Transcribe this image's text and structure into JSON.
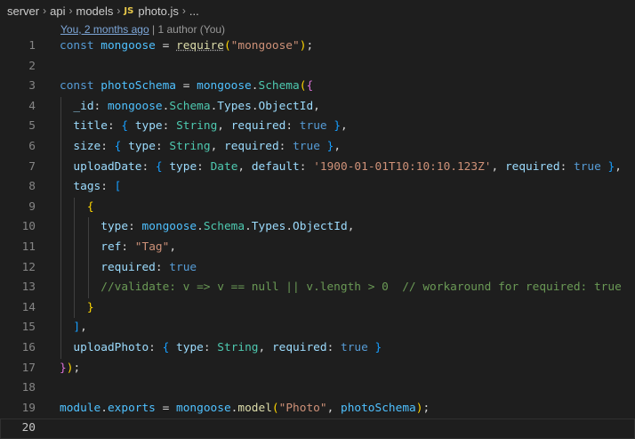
{
  "breadcrumb": {
    "items": [
      "server",
      "api",
      "models"
    ],
    "file_badge": "JS",
    "file_name": "photo.js",
    "trailing": "..."
  },
  "blame": {
    "link": "You, 2 months ago",
    "sep": " | ",
    "author": "1 author (You)"
  },
  "editor": {
    "current_line": 20,
    "lines": [
      {
        "n": "1",
        "tokens": [
          [
            "kw",
            "const"
          ],
          [
            "pun",
            " "
          ],
          [
            "var",
            "mongoose"
          ],
          [
            "pun",
            " = "
          ],
          [
            "fn",
            "require"
          ],
          [
            "b1",
            "("
          ],
          [
            "str",
            "\"mongoose\""
          ],
          [
            "b1",
            ")"
          ],
          [
            "pun",
            ";"
          ]
        ]
      },
      {
        "n": "2",
        "tokens": []
      },
      {
        "n": "3",
        "tokens": [
          [
            "kw",
            "const"
          ],
          [
            "pun",
            " "
          ],
          [
            "var",
            "photoSchema"
          ],
          [
            "pun",
            " = "
          ],
          [
            "var",
            "mongoose"
          ],
          [
            "pun",
            "."
          ],
          [
            "typ",
            "Schema"
          ],
          [
            "b1",
            "("
          ],
          [
            "b2",
            "{"
          ]
        ]
      },
      {
        "n": "4",
        "tokens": [
          [
            "pun",
            "  "
          ],
          [
            "prop",
            "_id"
          ],
          [
            "pun",
            ": "
          ],
          [
            "var",
            "mongoose"
          ],
          [
            "pun",
            "."
          ],
          [
            "typ",
            "Schema"
          ],
          [
            "pun",
            "."
          ],
          [
            "prop",
            "Types"
          ],
          [
            "pun",
            "."
          ],
          [
            "prop",
            "ObjectId"
          ],
          [
            "pun",
            ","
          ]
        ]
      },
      {
        "n": "5",
        "tokens": [
          [
            "pun",
            "  "
          ],
          [
            "prop",
            "title"
          ],
          [
            "pun",
            ": "
          ],
          [
            "b3",
            "{"
          ],
          [
            "pun",
            " "
          ],
          [
            "prop",
            "type"
          ],
          [
            "pun",
            ": "
          ],
          [
            "typ",
            "String"
          ],
          [
            "pun",
            ", "
          ],
          [
            "prop",
            "required"
          ],
          [
            "pun",
            ": "
          ],
          [
            "kw",
            "true"
          ],
          [
            "pun",
            " "
          ],
          [
            "b3",
            "}"
          ],
          [
            "pun",
            ","
          ]
        ]
      },
      {
        "n": "6",
        "tokens": [
          [
            "pun",
            "  "
          ],
          [
            "prop",
            "size"
          ],
          [
            "pun",
            ": "
          ],
          [
            "b3",
            "{"
          ],
          [
            "pun",
            " "
          ],
          [
            "prop",
            "type"
          ],
          [
            "pun",
            ": "
          ],
          [
            "typ",
            "String"
          ],
          [
            "pun",
            ", "
          ],
          [
            "prop",
            "required"
          ],
          [
            "pun",
            ": "
          ],
          [
            "kw",
            "true"
          ],
          [
            "pun",
            " "
          ],
          [
            "b3",
            "}"
          ],
          [
            "pun",
            ","
          ]
        ]
      },
      {
        "n": "7",
        "tokens": [
          [
            "pun",
            "  "
          ],
          [
            "prop",
            "uploadDate"
          ],
          [
            "pun",
            ": "
          ],
          [
            "b3",
            "{"
          ],
          [
            "pun",
            " "
          ],
          [
            "prop",
            "type"
          ],
          [
            "pun",
            ": "
          ],
          [
            "typ",
            "Date"
          ],
          [
            "pun",
            ", "
          ],
          [
            "prop",
            "default"
          ],
          [
            "pun",
            ": "
          ],
          [
            "str",
            "'1900-01-01T10:10:10.123Z'"
          ],
          [
            "pun",
            ", "
          ],
          [
            "prop",
            "required"
          ],
          [
            "pun",
            ": "
          ],
          [
            "kw",
            "true"
          ],
          [
            "pun",
            " "
          ],
          [
            "b3",
            "}"
          ],
          [
            "pun",
            ","
          ]
        ]
      },
      {
        "n": "8",
        "tokens": [
          [
            "pun",
            "  "
          ],
          [
            "prop",
            "tags"
          ],
          [
            "pun",
            ": "
          ],
          [
            "b3",
            "["
          ]
        ]
      },
      {
        "n": "9",
        "tokens": [
          [
            "pun",
            "    "
          ],
          [
            "b1",
            "{"
          ]
        ]
      },
      {
        "n": "10",
        "tokens": [
          [
            "pun",
            "      "
          ],
          [
            "prop",
            "type"
          ],
          [
            "pun",
            ": "
          ],
          [
            "var",
            "mongoose"
          ],
          [
            "pun",
            "."
          ],
          [
            "typ",
            "Schema"
          ],
          [
            "pun",
            "."
          ],
          [
            "prop",
            "Types"
          ],
          [
            "pun",
            "."
          ],
          [
            "prop",
            "ObjectId"
          ],
          [
            "pun",
            ","
          ]
        ]
      },
      {
        "n": "11",
        "tokens": [
          [
            "pun",
            "      "
          ],
          [
            "prop",
            "ref"
          ],
          [
            "pun",
            ": "
          ],
          [
            "str",
            "\"Tag\""
          ],
          [
            "pun",
            ","
          ]
        ]
      },
      {
        "n": "12",
        "tokens": [
          [
            "pun",
            "      "
          ],
          [
            "prop",
            "required"
          ],
          [
            "pun",
            ": "
          ],
          [
            "kw",
            "true"
          ]
        ]
      },
      {
        "n": "13",
        "tokens": [
          [
            "pun",
            "      "
          ],
          [
            "com",
            "//validate: v => v == null || v.length > 0  // workaround for required: true"
          ]
        ]
      },
      {
        "n": "14",
        "tokens": [
          [
            "pun",
            "    "
          ],
          [
            "b1",
            "}"
          ]
        ]
      },
      {
        "n": "15",
        "tokens": [
          [
            "pun",
            "  "
          ],
          [
            "b3",
            "]"
          ],
          [
            "pun",
            ","
          ]
        ]
      },
      {
        "n": "16",
        "tokens": [
          [
            "pun",
            "  "
          ],
          [
            "prop",
            "uploadPhoto"
          ],
          [
            "pun",
            ": "
          ],
          [
            "b3",
            "{"
          ],
          [
            "pun",
            " "
          ],
          [
            "prop",
            "type"
          ],
          [
            "pun",
            ": "
          ],
          [
            "typ",
            "String"
          ],
          [
            "pun",
            ", "
          ],
          [
            "prop",
            "required"
          ],
          [
            "pun",
            ": "
          ],
          [
            "kw",
            "true"
          ],
          [
            "pun",
            " "
          ],
          [
            "b3",
            "}"
          ]
        ]
      },
      {
        "n": "17",
        "tokens": [
          [
            "b2",
            "}"
          ],
          [
            "b1",
            ")"
          ],
          [
            "pun",
            ";"
          ]
        ]
      },
      {
        "n": "18",
        "tokens": []
      },
      {
        "n": "19",
        "tokens": [
          [
            "var",
            "module"
          ],
          [
            "pun",
            "."
          ],
          [
            "var",
            "exports"
          ],
          [
            "pun",
            " = "
          ],
          [
            "var",
            "mongoose"
          ],
          [
            "pun",
            "."
          ],
          [
            "fn",
            "model"
          ],
          [
            "b1",
            "("
          ],
          [
            "str",
            "\"Photo\""
          ],
          [
            "pun",
            ", "
          ],
          [
            "var",
            "photoSchema"
          ],
          [
            "b1",
            ")"
          ],
          [
            "pun",
            ";"
          ]
        ]
      },
      {
        "n": "20",
        "tokens": []
      }
    ]
  }
}
